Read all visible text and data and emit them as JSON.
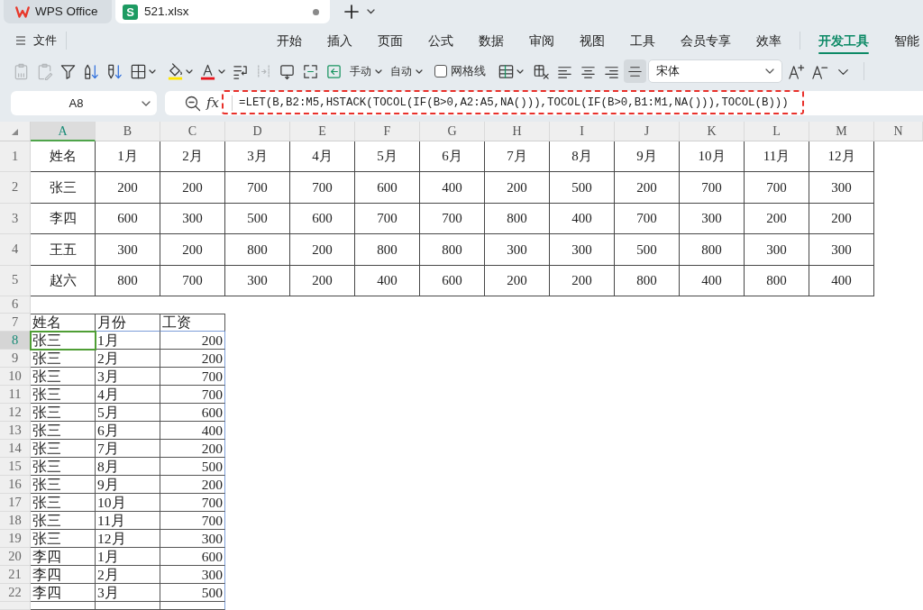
{
  "window": {
    "tabs": [
      {
        "kind": "home",
        "label": "WPS Office",
        "selected": false
      },
      {
        "kind": "sheet",
        "badge": "S",
        "label": "521.xlsx",
        "selected": true,
        "modified": true
      }
    ]
  },
  "menu": {
    "file": "文件",
    "tabs": [
      {
        "label": "开始",
        "selected": false
      },
      {
        "label": "插入",
        "selected": false
      },
      {
        "label": "页面",
        "selected": false
      },
      {
        "label": "公式",
        "selected": false
      },
      {
        "label": "数据",
        "selected": false
      },
      {
        "label": "审阅",
        "selected": false
      },
      {
        "label": "视图",
        "selected": false
      },
      {
        "label": "工具",
        "selected": false
      },
      {
        "label": "会员专享",
        "selected": false
      },
      {
        "label": "效率",
        "selected": false
      },
      {
        "label": "开发工具",
        "selected": true,
        "separator_before": true
      },
      {
        "label": "智能",
        "selected": false
      }
    ]
  },
  "toolbar": [
    {
      "kind": "paste-values",
      "disabled": true,
      "dropdown": false
    },
    {
      "kind": "paste-format",
      "disabled": true,
      "dropdown": false
    },
    {
      "kind": "filter",
      "disabled": false,
      "dropdown": false
    },
    {
      "kind": "sort-ascending",
      "disabled": false,
      "dropdown": false
    },
    {
      "kind": "sort-descending",
      "disabled": false,
      "dropdown": false
    },
    {
      "kind": "borders",
      "disabled": false,
      "dropdown": true
    },
    {
      "kind": "fill-color",
      "disabled": false,
      "dropdown": true
    },
    {
      "kind": "font-color",
      "disabled": false,
      "dropdown": true
    },
    {
      "kind": "wrap-text",
      "disabled": false,
      "dropdown": false
    },
    {
      "kind": "split-columns",
      "disabled": true,
      "dropdown": false
    },
    {
      "kind": "frame-arrow",
      "disabled": false,
      "dropdown": false
    },
    {
      "kind": "frame-corners",
      "disabled": false,
      "dropdown": false
    },
    {
      "kind": "arrow-box",
      "disabled": false,
      "dropdown": false
    },
    {
      "kind": "menu-text",
      "label": "手动",
      "disabled": false,
      "dropdown": true
    },
    {
      "kind": "menu-text",
      "label": "自动",
      "disabled": false,
      "dropdown": true
    },
    {
      "kind": "checkbox",
      "label": "网格线",
      "checked": false
    },
    {
      "kind": "table",
      "disabled": false,
      "dropdown": true
    },
    {
      "kind": "table-delete",
      "disabled": false,
      "dropdown": false
    },
    {
      "kind": "align-left",
      "disabled": false,
      "dropdown": false,
      "selected": false
    },
    {
      "kind": "align-center",
      "disabled": false,
      "dropdown": false,
      "selected": false
    },
    {
      "kind": "align-right",
      "disabled": false,
      "dropdown": false,
      "selected": false
    },
    {
      "kind": "align-middle",
      "disabled": false,
      "dropdown": false,
      "selected": true
    },
    {
      "kind": "font-select",
      "value": "宋体"
    },
    {
      "kind": "font-grow",
      "disabled": false,
      "dropdown": false
    },
    {
      "kind": "font-shrink",
      "disabled": false,
      "dropdown": false
    },
    {
      "kind": "more",
      "disabled": false,
      "dropdown": false
    }
  ],
  "formula_bar": {
    "name_box": "A8",
    "function_symbol": "fx",
    "formula": "=LET(B,B2:M5,HSTACK(TOCOL(IF(B>0,A2:A5,NA())),TOCOL(IF(B>0,B1:M1,NA())),TOCOL(B)))"
  },
  "sheet": {
    "columns": [
      {
        "label": "A",
        "selected": true
      },
      {
        "label": "B",
        "selected": false
      },
      {
        "label": "C",
        "selected": false
      },
      {
        "label": "D",
        "selected": false
      },
      {
        "label": "E",
        "selected": false
      },
      {
        "label": "F",
        "selected": false
      },
      {
        "label": "G",
        "selected": false
      },
      {
        "label": "H",
        "selected": false
      },
      {
        "label": "I",
        "selected": false
      },
      {
        "label": "J",
        "selected": false
      },
      {
        "label": "K",
        "selected": false
      },
      {
        "label": "L",
        "selected": false
      },
      {
        "label": "M",
        "selected": false
      },
      {
        "label": "N",
        "selected": false
      }
    ],
    "rows": [
      {
        "number": "1",
        "kind": "table",
        "selected": false,
        "cells": [
          "姓名",
          "1月",
          "2月",
          "3月",
          "4月",
          "5月",
          "6月",
          "7月",
          "8月",
          "9月",
          "10月",
          "11月",
          "12月"
        ]
      },
      {
        "number": "2",
        "kind": "table",
        "selected": false,
        "cells": [
          "张三",
          "200",
          "200",
          "700",
          "700",
          "600",
          "400",
          "200",
          "500",
          "200",
          "700",
          "700",
          "300"
        ]
      },
      {
        "number": "3",
        "kind": "table",
        "selected": false,
        "cells": [
          "李四",
          "600",
          "300",
          "500",
          "600",
          "700",
          "700",
          "800",
          "400",
          "700",
          "300",
          "200",
          "200"
        ]
      },
      {
        "number": "4",
        "kind": "table",
        "selected": false,
        "cells": [
          "王五",
          "300",
          "200",
          "800",
          "200",
          "800",
          "800",
          "300",
          "300",
          "500",
          "800",
          "300",
          "300"
        ]
      },
      {
        "number": "5",
        "kind": "table",
        "selected": false,
        "cells": [
          "赵六",
          "800",
          "700",
          "300",
          "200",
          "400",
          "600",
          "200",
          "200",
          "800",
          "400",
          "800",
          "400"
        ]
      },
      {
        "number": "6",
        "kind": "blank",
        "selected": false
      },
      {
        "number": "7",
        "kind": "list-header",
        "selected": false,
        "cells": [
          "姓名",
          "月份",
          "工资"
        ]
      },
      {
        "number": "8",
        "kind": "list",
        "selected": true,
        "cells": [
          "张三",
          "1月",
          "200"
        ]
      },
      {
        "number": "9",
        "kind": "list",
        "selected": false,
        "cells": [
          "张三",
          "2月",
          "200"
        ]
      },
      {
        "number": "10",
        "kind": "list",
        "selected": false,
        "cells": [
          "张三",
          "3月",
          "700"
        ]
      },
      {
        "number": "11",
        "kind": "list",
        "selected": false,
        "cells": [
          "张三",
          "4月",
          "700"
        ]
      },
      {
        "number": "12",
        "kind": "list",
        "selected": false,
        "cells": [
          "张三",
          "5月",
          "600"
        ]
      },
      {
        "number": "13",
        "kind": "list",
        "selected": false,
        "cells": [
          "张三",
          "6月",
          "400"
        ]
      },
      {
        "number": "14",
        "kind": "list",
        "selected": false,
        "cells": [
          "张三",
          "7月",
          "200"
        ]
      },
      {
        "number": "15",
        "kind": "list",
        "selected": false,
        "cells": [
          "张三",
          "8月",
          "500"
        ]
      },
      {
        "number": "16",
        "kind": "list",
        "selected": false,
        "cells": [
          "张三",
          "9月",
          "200"
        ]
      },
      {
        "number": "17",
        "kind": "list",
        "selected": false,
        "cells": [
          "张三",
          "10月",
          "700"
        ]
      },
      {
        "number": "18",
        "kind": "list",
        "selected": false,
        "cells": [
          "张三",
          "11月",
          "700"
        ]
      },
      {
        "number": "19",
        "kind": "list",
        "selected": false,
        "cells": [
          "张三",
          "12月",
          "300"
        ]
      },
      {
        "number": "20",
        "kind": "list",
        "selected": false,
        "cells": [
          "李四",
          "1月",
          "600"
        ]
      },
      {
        "number": "21",
        "kind": "list",
        "selected": false,
        "cells": [
          "李四",
          "2月",
          "300"
        ]
      },
      {
        "number": "22",
        "kind": "list",
        "selected": false,
        "cells": [
          "李四",
          "3月",
          "500"
        ]
      }
    ]
  }
}
